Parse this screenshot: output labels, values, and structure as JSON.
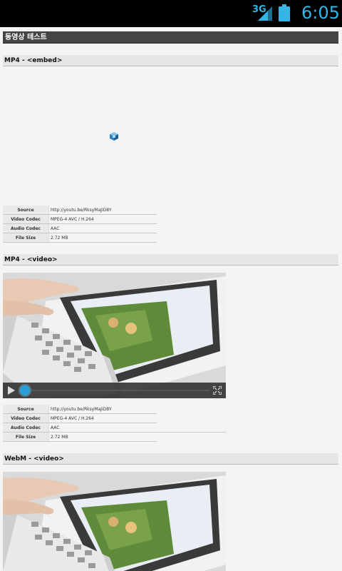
{
  "status_bar": {
    "network": "3G",
    "time": "6:05"
  },
  "page_title": "동영상 테스트",
  "sections": [
    {
      "header": "MP4 - <embed>",
      "info": [
        {
          "key": "Source",
          "value": "http://youtu.be/RksyMaJiD8Y"
        },
        {
          "key": "Video Codec",
          "value": "MPEG-4 AVC / H.264"
        },
        {
          "key": "Audio Codec",
          "value": "AAC"
        },
        {
          "key": "File Size",
          "value": "2.72 MB"
        }
      ]
    },
    {
      "header": "MP4 - <video>",
      "info": [
        {
          "key": "Source",
          "value": "http://youtu.be/RksyMaJiD8Y"
        },
        {
          "key": "Video Codec",
          "value": "MPEG-4 AVC / H.264"
        },
        {
          "key": "Audio Codec",
          "value": "AAC"
        },
        {
          "key": "File Size",
          "value": "2.72 MB"
        }
      ]
    },
    {
      "header": "WebM - <video>"
    }
  ],
  "video_player": {
    "progress": 0.0
  },
  "colors": {
    "accent": "#33b5e5",
    "title_bar": "#444444",
    "background": "#f4f4f4"
  }
}
